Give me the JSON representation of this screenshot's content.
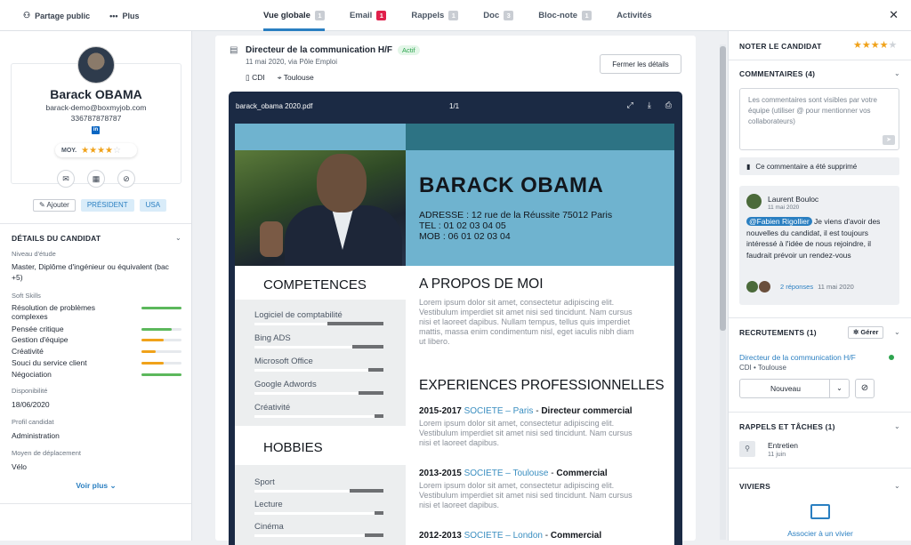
{
  "topbar": {
    "share": "Partage public",
    "more": "Plus",
    "tabs": [
      {
        "label": "Vue globale",
        "count": "1"
      },
      {
        "label": "Email",
        "count": "1"
      },
      {
        "label": "Rappels",
        "count": "1"
      },
      {
        "label": "Doc",
        "count": "3"
      },
      {
        "label": "Bloc-note",
        "count": "1"
      },
      {
        "label": "Activités",
        "count": ""
      }
    ]
  },
  "candidate": {
    "name": "Barack OBAMA",
    "email": "barack-demo@boxmyjob.com",
    "phone": "336787878787",
    "linkedin": "in",
    "rating_label": "MOY.",
    "rating": 3.5,
    "add_label": "Ajouter",
    "tags": [
      "PRÉSIDENT",
      "USA"
    ]
  },
  "details": {
    "title": "DÉTAILS DU CANDIDAT",
    "niveau_label": "Niveau d'étude",
    "niveau": "Master, Diplôme d'ingénieur ou équivalent (bac +5)",
    "softskills_label": "Soft Skills",
    "skills": [
      {
        "name": "Résolution de problèmes complexes",
        "level": 1.0,
        "color": "#5cb85c"
      },
      {
        "name": "Pensée critique",
        "level": 0.75,
        "color": "#5cb85c"
      },
      {
        "name": "Gestion d'équipe",
        "level": 0.55,
        "color": "#f0a21a"
      },
      {
        "name": "Créativité",
        "level": 0.35,
        "color": "#f0a21a"
      },
      {
        "name": "Souci du service client",
        "level": 0.55,
        "color": "#f0a21a"
      },
      {
        "name": "Négociation",
        "level": 1.0,
        "color": "#5cb85c"
      }
    ],
    "dispo_label": "Disponibilité",
    "dispo": "18/06/2020",
    "profil_label": "Profil candidat",
    "profil": "Administration",
    "moyen_label": "Moyen de déplacement",
    "moyen": "Vélo",
    "voir_plus": "Voir plus"
  },
  "job": {
    "title": "Directeur de la communication H/F",
    "status": "Actif",
    "sub": "11 mai 2020, via Pôle Emploi",
    "contract": "CDI",
    "location": "Toulouse",
    "close_btn": "Fermer les détails"
  },
  "viewer": {
    "file": "barack_obama 2020.pdf",
    "page": "1/1"
  },
  "cv": {
    "name": "BARACK OBAMA",
    "addr1": "ADRESSE : 12 rue de la Réussite 75012 Paris",
    "addr2": "TEL : 01 02 03 04 05",
    "addr3": "MOB : 06 01 02 03 04",
    "competences_title": "COMPETENCES",
    "competences": [
      {
        "name": "Logiciel de  comptabilité",
        "level": 0.9
      },
      {
        "name": "Bing ADS",
        "level": 0.5
      },
      {
        "name": "Microsoft Office",
        "level": 0.25
      },
      {
        "name": "Google Adwords",
        "level": 0.4
      },
      {
        "name": "Créativité",
        "level": 0.1
      }
    ],
    "hobbies_title": "HOBBIES",
    "hobbies": [
      {
        "name": "Sport",
        "level": 0.55
      },
      {
        "name": "Lecture",
        "level": 0.12
      },
      {
        "name": "Cinéma",
        "level": 0.3
      }
    ],
    "about_title": "A PROPOS DE MOI",
    "about_text": "Lorem ipsum dolor sit amet, consectetur adipiscing elit. Vestibulum imperdiet sit amet nisi sed tincidunt. Nam cursus nisi et laoreet dapibus. Nullam tempus, tellus quis imperdiet mattis, massa enim condimentum nisl, eget iaculis nibh diam ut libero.",
    "exp_title": "EXPERIENCES PROFESSIONNELLES",
    "exp": [
      {
        "years": "2015-2017",
        "company": "SOCIETE – Paris",
        "role": "Directeur commercial",
        "text": "Lorem ipsum dolor sit amet, consectetur adipiscing elit. Vestibulum imperdiet sit amet nisi sed tincidunt. Nam cursus nisi et laoreet dapibus."
      },
      {
        "years": "2013-2015",
        "company": "SOCIETE – Toulouse",
        "role": "Commercial",
        "text": "Lorem ipsum dolor sit amet, consectetur adipiscing elit. Vestibulum imperdiet sit amet nisi sed tincidunt. Nam cursus nisi et laoreet dapibus."
      },
      {
        "years": "2012-2013",
        "company": "SOCIETE – London",
        "role": "Commercial",
        "text": ""
      }
    ]
  },
  "right": {
    "rate_title": "NOTER LE CANDIDAT",
    "rate": 4,
    "comments_title": "COMMENTAIRES (4)",
    "comment_placeholder": "Les commentaires sont visibles par votre équipe (utiliser @ pour mentionner vos collaborateurs)",
    "deleted": "Ce commentaire a été supprimé",
    "comment": {
      "author": "Laurent Bouloc",
      "date": "11 mai 2020",
      "mention": "@Fabien Rigollier",
      "text": " Je viens d'avoir des nouvelles du candidat, il est toujours intéressé à l'idée de nous rejoindre, il faudrait prévoir un rendez-vous",
      "replies": "2 réponses",
      "replies_date": "11 mai 2020"
    },
    "recrutements_title": "RECRUTEMENTS (1)",
    "gerer": "Gérer",
    "rec_job": "Directeur de la communication H/F",
    "rec_sub": "CDI • Toulouse",
    "rec_status": "Nouveau",
    "rappels_title": "RAPPELS ET TÂCHES (1)",
    "task_title": "Entretien",
    "task_date": "11 juin",
    "viviers_title": "VIVIERS",
    "assoc": "Associer à un vivier"
  },
  "colors": {
    "accent": "#2a7fc1",
    "star": "#f0a21a",
    "cv_blue": "#6fb3cf",
    "cv_teal": "#2d7384"
  }
}
